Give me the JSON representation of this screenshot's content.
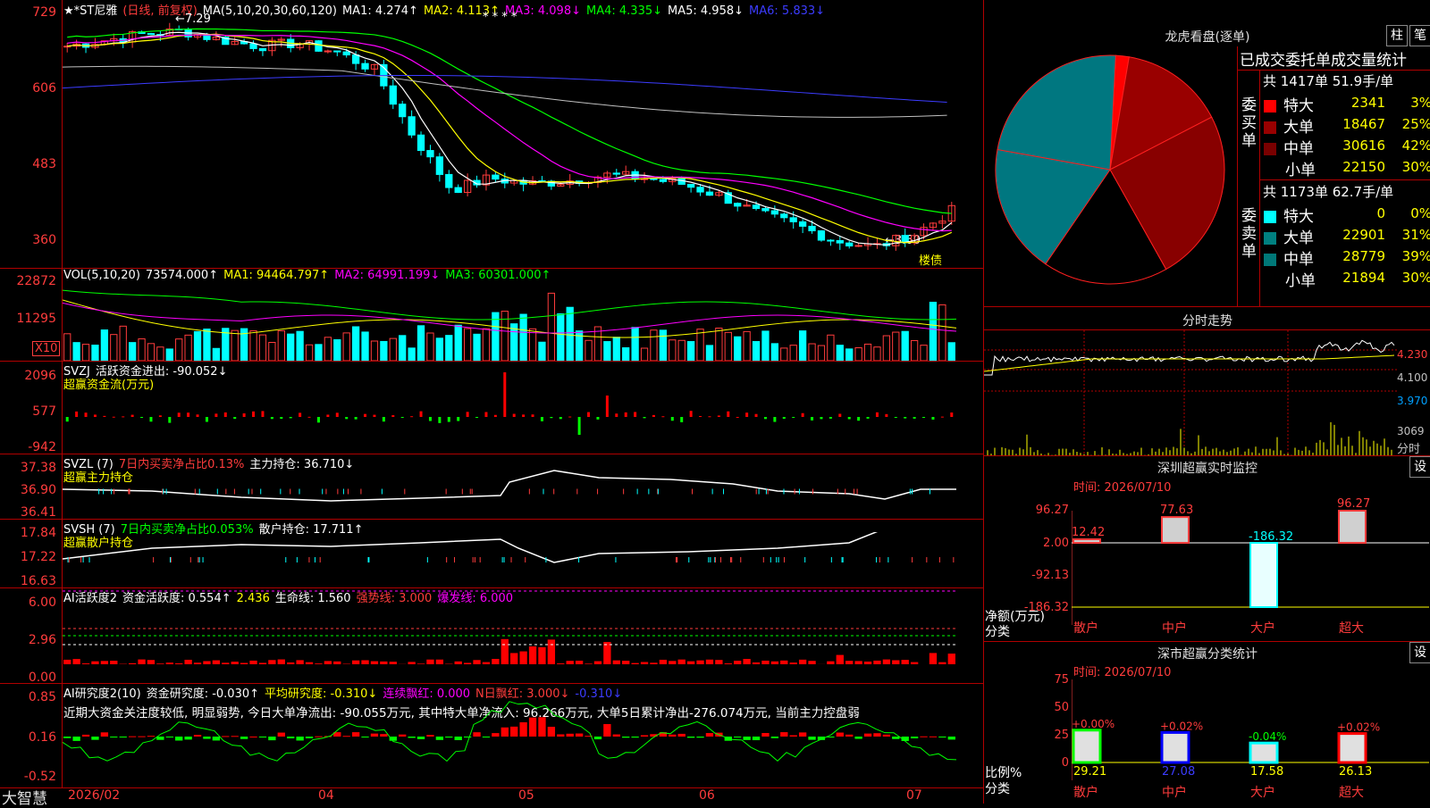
{
  "brand": "大智慧",
  "main": {
    "header": {
      "stock": "★*ST尼雅",
      "period": "(日线, 前复权)",
      "ma_def": "MA(5,10,20,30,60,120)",
      "ma1": "MA1: 4.274↑",
      "ma2": "MA2: 4.113↑",
      "ma3": "MA3: 4.098↓",
      "ma4": "MA4: 4.335↓",
      "ma5": "MA5: 4.958↓",
      "ma6": "MA6: 5.833↓"
    },
    "yticks": [
      "729",
      "606",
      "483",
      "360"
    ],
    "high_label": "←7.29",
    "low_label": "←3.60",
    "event_tag": "楼债",
    "star_marks": "*  *  *  *"
  },
  "vol": {
    "header": {
      "name": "VOL(5,10,20)",
      "v": "73574.000↑",
      "ma1": "MA1: 94464.797↑",
      "ma2": "MA2: 64991.199↓",
      "ma3": "MA3: 60301.000↑"
    },
    "yticks": [
      "22872",
      "11295"
    ],
    "unit": "X10"
  },
  "svzj": {
    "header": {
      "name": "SVZJ",
      "desc": "活跃资金进出: -90.052↓",
      "sub": "超赢资金流(万元)"
    },
    "yticks": [
      "2096",
      "577",
      "-942"
    ]
  },
  "svzl": {
    "header": {
      "name": "SVZL (7)",
      "ratio": "7日内买卖净占比0.13%",
      "hold": "主力持仓: 36.710↓",
      "sub": "超赢主力持仓"
    },
    "yticks": [
      "37.38",
      "36.90",
      "36.41"
    ]
  },
  "svsh": {
    "header": {
      "name": "SVSH (7)",
      "ratio": "7日内买卖净占比0.053%",
      "hold": "散户持仓: 17.711↑",
      "sub": "超赢散户持仓"
    },
    "yticks": [
      "17.84",
      "17.22",
      "16.63"
    ]
  },
  "ai_active": {
    "header": {
      "name": "AI活跃度2",
      "a": "资金活跃度: 0.554↑",
      "b": "2.436",
      "c": "生命线: 1.560",
      "d": "强势线: 3.000",
      "e": "爆发线: 6.000"
    },
    "yticks": [
      "6.00",
      "2.96",
      "0.00"
    ]
  },
  "ai_research": {
    "header": {
      "name": "AI研究度2(10)",
      "a": "资金研究度: -0.030↑",
      "b": "平均研究度: -0.310↓",
      "c": "连续飘红: 0.000",
      "d": "N日飘红: 3.000↓",
      "e": "-0.310↓"
    },
    "comment": "近期大资金关注度较低, 明显弱势, 今日大单净流出: -90.055万元, 其中特大单净流入: 96.266万元, 大单5日累计净出-276.074万元, 当前主力控盘弱",
    "yticks": [
      "0.85",
      "0.16",
      "-0.52"
    ]
  },
  "xaxis": [
    "2026/02",
    "04",
    "05",
    "06",
    "07"
  ],
  "right": {
    "lhb_title": "龙虎看盘(逐单)",
    "btn_bar": "柱",
    "btn_pen": "笔",
    "stat_title": "已成交委托单成交量统计",
    "buy_label": "委买单",
    "buy_total": "共 1417单 51.9手/单",
    "buy_rows": [
      {
        "name": "特大",
        "vol": "2341",
        "pct": "3%",
        "color": "#ff0000"
      },
      {
        "name": "大单",
        "vol": "18467",
        "pct": "25%",
        "color": "#990000"
      },
      {
        "name": "中单",
        "vol": "30616",
        "pct": "42%",
        "color": "#7a0000"
      },
      {
        "name": "小单",
        "vol": "22150",
        "pct": "30%",
        "color": "#000000"
      }
    ],
    "sell_label": "委卖单",
    "sell_total": "共 1173单 62.7手/单",
    "sell_rows": [
      {
        "name": "特大",
        "vol": "0",
        "pct": "0%",
        "color": "#00ffff"
      },
      {
        "name": "大单",
        "vol": "22901",
        "pct": "31%",
        "color": "#008080"
      },
      {
        "name": "中单",
        "vol": "28779",
        "pct": "39%",
        "color": "#007878"
      },
      {
        "name": "小单",
        "vol": "21894",
        "pct": "30%",
        "color": "#000000"
      }
    ],
    "pie_slices": [
      {
        "label": "买特大",
        "value": 2341,
        "color": "#ff0000"
      },
      {
        "label": "买大单",
        "value": 18467,
        "color": "#990000"
      },
      {
        "label": "买中单",
        "value": 30616,
        "color": "#880000"
      },
      {
        "label": "买小单",
        "value": 22150,
        "color": "#000000"
      },
      {
        "label": "卖大单",
        "value": 22901,
        "color": "#007780"
      },
      {
        "label": "卖中单",
        "value": 28779,
        "color": "#007780"
      }
    ],
    "intraday_title": "分时走势",
    "intraday_yticks": [
      "4.230",
      "4.100",
      "3.970"
    ],
    "intraday_vol_label": "3069",
    "intraday_x_label": "分时",
    "sz_title": "深圳超赢实时监控",
    "sz_btn": "设",
    "sz_time": "时间: 2026/07/10",
    "sz_yticks": [
      "96.27",
      "2.00",
      "-92.13",
      "-186.32"
    ],
    "sz_ylabel": "净额(万元)",
    "sz_xlabel": "分类",
    "sz_cats": [
      "散户",
      "中户",
      "大户",
      "超大"
    ],
    "sz_values": [
      12.42,
      77.63,
      -186.32,
      96.27
    ],
    "sz_value_labels": [
      "12.42",
      "77.63",
      "-186.32",
      "96.27"
    ],
    "cls_title": "深市超赢分类统计",
    "cls_btn": "设",
    "cls_time": "时间: 2026/07/10",
    "cls_yticks": [
      "75",
      "50",
      "25",
      "0"
    ],
    "cls_ylabel": "比例%",
    "cls_xlabel": "分类",
    "cls_cats": [
      "散户",
      "中户",
      "大户",
      "超大"
    ],
    "cls_values": [
      29.21,
      27.08,
      17.58,
      26.13
    ],
    "cls_value_labels": [
      "29.21",
      "27.08",
      "17.58",
      "26.13"
    ],
    "cls_change_labels": [
      "+0.00%",
      "+0.02%",
      "-0.04%",
      "+0.02%"
    ],
    "cls_colors": [
      "#00ff00",
      "#0000ff",
      "#00ffff",
      "#ff0000"
    ]
  },
  "chart_data": [
    {
      "type": "candlestick",
      "title": "★*ST尼雅 (日线, 前复权)",
      "x": [
        "2026/02",
        "04",
        "05",
        "06",
        "07"
      ],
      "close_approx": [
        7.0,
        7.1,
        7.2,
        7.25,
        7.1,
        7.0,
        7.05,
        6.9,
        6.6,
        5.5,
        4.6,
        4.8,
        4.7,
        4.75,
        4.85,
        4.8,
        4.7,
        4.5,
        4.2,
        4.0,
        3.75,
        3.65,
        3.85,
        4.25
      ],
      "ylim": [
        3.3,
        7.5
      ],
      "annotations": [
        "←7.29",
        "←3.60"
      ]
    },
    {
      "type": "bar",
      "title": "VOL(5,10,20)",
      "ylabel": "X10",
      "ylim": [
        0,
        22872
      ]
    },
    {
      "type": "pie",
      "title": "龙虎看盘(逐单)",
      "categories": [
        "买特大",
        "买大单",
        "买中单",
        "买小单",
        "卖特大",
        "卖大单",
        "卖中单",
        "卖小单"
      ],
      "values": [
        2341,
        18467,
        30616,
        22150,
        0,
        22901,
        28779,
        21894
      ]
    },
    {
      "type": "bar",
      "title": "深圳超赢实时监控",
      "categories": [
        "散户",
        "中户",
        "大户",
        "超大"
      ],
      "values": [
        12.42,
        77.63,
        -186.32,
        96.27
      ],
      "ylabel": "净额(万元)",
      "ylim": [
        -186.32,
        96.27
      ]
    },
    {
      "type": "bar",
      "title": "深市超赢分类统计",
      "categories": [
        "散户",
        "中户",
        "大户",
        "超大"
      ],
      "values": [
        29.21,
        27.08,
        17.58,
        26.13
      ],
      "ylabel": "比例%",
      "ylim": [
        0,
        75
      ]
    }
  ]
}
